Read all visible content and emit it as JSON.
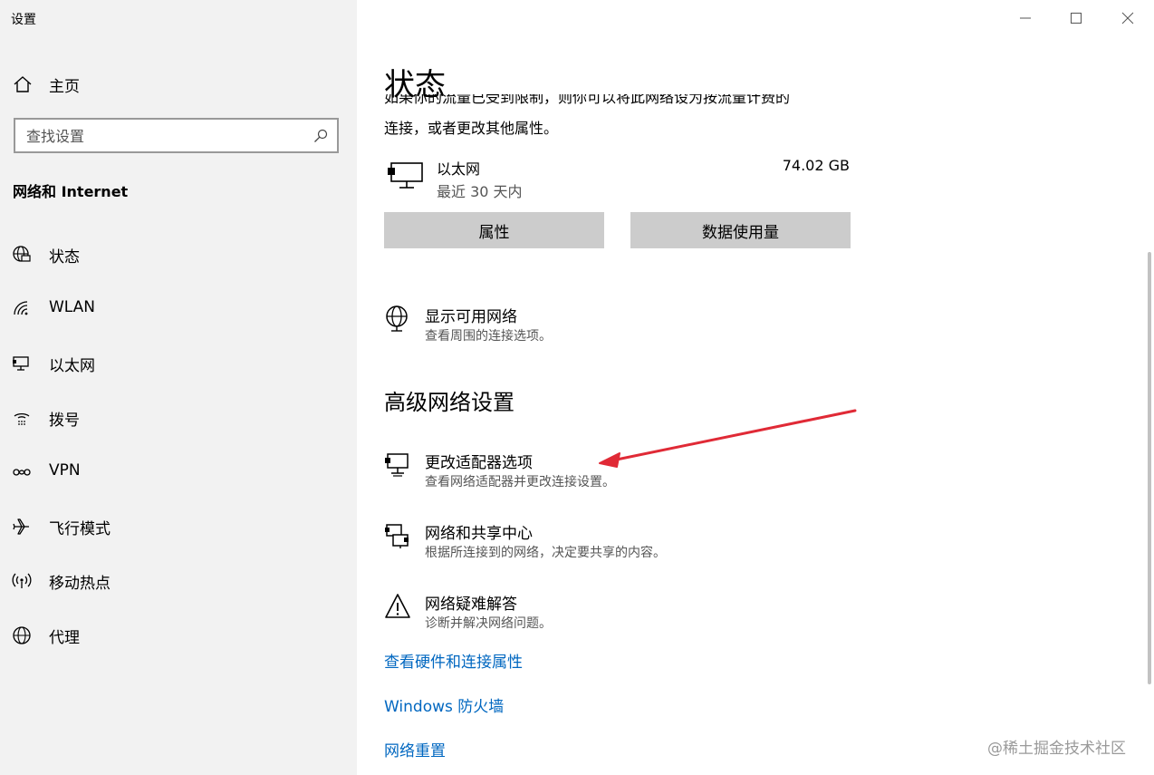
{
  "window": {
    "title": "设置"
  },
  "sidebar": {
    "home_label": "主页",
    "search_placeholder": "查找设置",
    "section_title": "网络和 Internet",
    "items": [
      {
        "label": "状态",
        "icon": "globe-monitor-icon"
      },
      {
        "label": "WLAN",
        "icon": "wifi-icon"
      },
      {
        "label": "以太网",
        "icon": "ethernet-icon"
      },
      {
        "label": "拨号",
        "icon": "dialup-icon"
      },
      {
        "label": "VPN",
        "icon": "vpn-icon"
      },
      {
        "label": "飞行模式",
        "icon": "airplane-icon"
      },
      {
        "label": "移动热点",
        "icon": "hotspot-icon"
      },
      {
        "label": "代理",
        "icon": "globe-icon"
      }
    ]
  },
  "main": {
    "title": "状态",
    "intro_clipped": "如果你的流量已受到限制，则你可以将此网络设为按流量计费的",
    "intro_tail": "连接，或者更改其他属性。",
    "ethernet": {
      "name": "以太网",
      "period": "最近 30 天内",
      "usage": "74.02 GB"
    },
    "buttons": {
      "properties": "属性",
      "data_usage": "数据使用量"
    },
    "show_networks": {
      "title": "显示可用网络",
      "desc": "查看周围的连接选项。"
    },
    "advanced_title": "高级网络设置",
    "advanced_items": [
      {
        "title": "更改适配器选项",
        "desc": "查看网络适配器并更改连接设置。",
        "icon": "adapter-icon"
      },
      {
        "title": "网络和共享中心",
        "desc": "根据所连接到的网络，决定要共享的内容。",
        "icon": "sharing-center-icon"
      },
      {
        "title": "网络疑难解答",
        "desc": "诊断并解决网络问题。",
        "icon": "warning-icon"
      }
    ],
    "links": [
      "查看硬件和连接属性",
      "Windows 防火墙",
      "网络重置"
    ]
  },
  "watermark": "@稀土掘金技术社区",
  "colors": {
    "sidebar_bg": "#f2f2f2",
    "button_bg": "#cccccc",
    "link": "#0067c0",
    "annotation_arrow": "#e02a36"
  }
}
